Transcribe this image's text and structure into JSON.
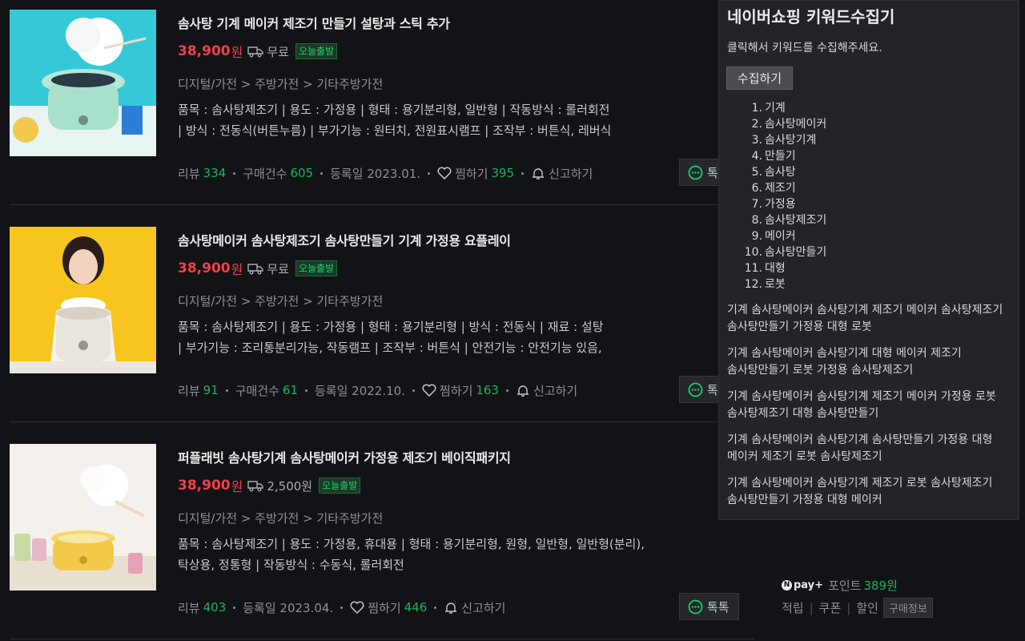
{
  "products": [
    {
      "title": "솜사탕 기계 메이커 제조기 만들기 설탕과 스틱 추가",
      "price": "38,900",
      "price_unit": "원",
      "shipping": "무료",
      "badge": "오늘출발",
      "category": "디지털/가전 > 주방가전 > 기타주방가전",
      "spec_lines": [
        "품목 : 솜사탕제조기  |  용도 : 가정용  |  형태 : 용기분리형, 일반형  |  작동방식 : 롤러회전",
        " |  방식 : 전동식(버튼누름)  |  부가기능 : 원터치, 전원표시램프  |  조작부 : 버튼식, 레버식"
      ],
      "meta": [
        {
          "label": "리뷰",
          "value": "334"
        },
        {
          "label": "구매건수",
          "value": "605"
        },
        {
          "label": "등록일 2023.01.",
          "value": ""
        }
      ],
      "zzim_label": "찜하기",
      "zzim_count": "395",
      "report_label": "신고하기",
      "talk_label": "톡톡"
    },
    {
      "title": "솜사탕메이커 솜사탕제조기 솜사탕만들기 기계 가정용 요플레이",
      "price": "38,900",
      "price_unit": "원",
      "shipping": "무료",
      "badge": "오늘출발",
      "category": "디지털/가전 > 주방가전 > 기타주방가전",
      "spec_lines": [
        "품목 : 솜사탕제조기  |  용도 : 가정용  |  형태 : 용기분리형  |  방식 : 전동식  |  재료 : 설탕",
        " |  부가기능 : 조리통분리가능, 작동램프  |  조작부 : 버튼식  |  안전기능 : 안전기능 있음,"
      ],
      "meta": [
        {
          "label": "리뷰",
          "value": "91"
        },
        {
          "label": "구매건수",
          "value": "61"
        },
        {
          "label": "등록일 2022.10.",
          "value": ""
        }
      ],
      "zzim_label": "찜하기",
      "zzim_count": "163",
      "report_label": "신고하기",
      "talk_label": "톡톡"
    },
    {
      "title": "퍼플래빗 솜사탕기계 솜사탕메이커 가정용 제조기 베이직패키지",
      "price": "38,900",
      "price_unit": "원",
      "shipping": "2,500원",
      "badge": "오늘출발",
      "category": "디지털/가전 > 주방가전 > 기타주방가전",
      "spec_lines": [
        "품목 : 솜사탕제조기  |  용도 : 가정용, 휴대용  |  형태 : 용기분리형, 원형, 일반형, 일반형(분리),",
        "탁상용, 정통형  |  작동방식 : 수동식, 롤러회전"
      ],
      "meta": [
        {
          "label": "리뷰",
          "value": "403"
        },
        {
          "label": "등록일 2023.04.",
          "value": ""
        }
      ],
      "zzim_label": "찜하기",
      "zzim_count": "446",
      "report_label": "신고하기",
      "talk_label": "톡톡"
    }
  ],
  "side_info": {
    "npay_logo": "pay",
    "npay_plus": "+",
    "point_label": "포인트",
    "point_value": "389원",
    "benefits": [
      "적립",
      "쿠폰",
      "할인"
    ],
    "info_button": "구매정보"
  },
  "panel": {
    "title": "네이버쇼핑 키워드수집기",
    "description": "클릭해서 키워드를 수집해주세요.",
    "button_label": "수집하기",
    "keywords": [
      "기계",
      "솜사탕메이커",
      "솜사탕기계",
      "만들기",
      "솜사탕",
      "제조기",
      "가정용",
      "솜사탕제조기",
      "메이커",
      "솜사탕만들기",
      "대형",
      "로봇"
    ],
    "combinations": [
      "기계 솜사탕메이커 솜사탕기계 제조기 메이커 솜사탕제조기 솜사탕만들기 가정용 대형 로봇",
      "기계 솜사탕메이커 솜사탕기계 대형 메이커 제조기 솜사탕만들기 로봇 가정용 솜사탕제조기",
      "기계 솜사탕메이커 솜사탕기계 제조기 메이커 가정용 로봇 솜사탕제조기 대형 솜사탕만들기",
      "기계 솜사탕메이커 솜사탕기계 솜사탕만들기 가정용 대형 메이커 제조기 로봇 솜사탕제조기",
      "기계 솜사탕메이커 솜사탕기계 제조기 로봇 솜사탕제조기 솜사탕만들기 가정용 대형 메이커"
    ]
  },
  "colors": {
    "background": "#121316",
    "price": "#f0404a",
    "accent_green": "#19b45f",
    "badge_green": "#19d06b",
    "panel_bg": "#222428"
  }
}
